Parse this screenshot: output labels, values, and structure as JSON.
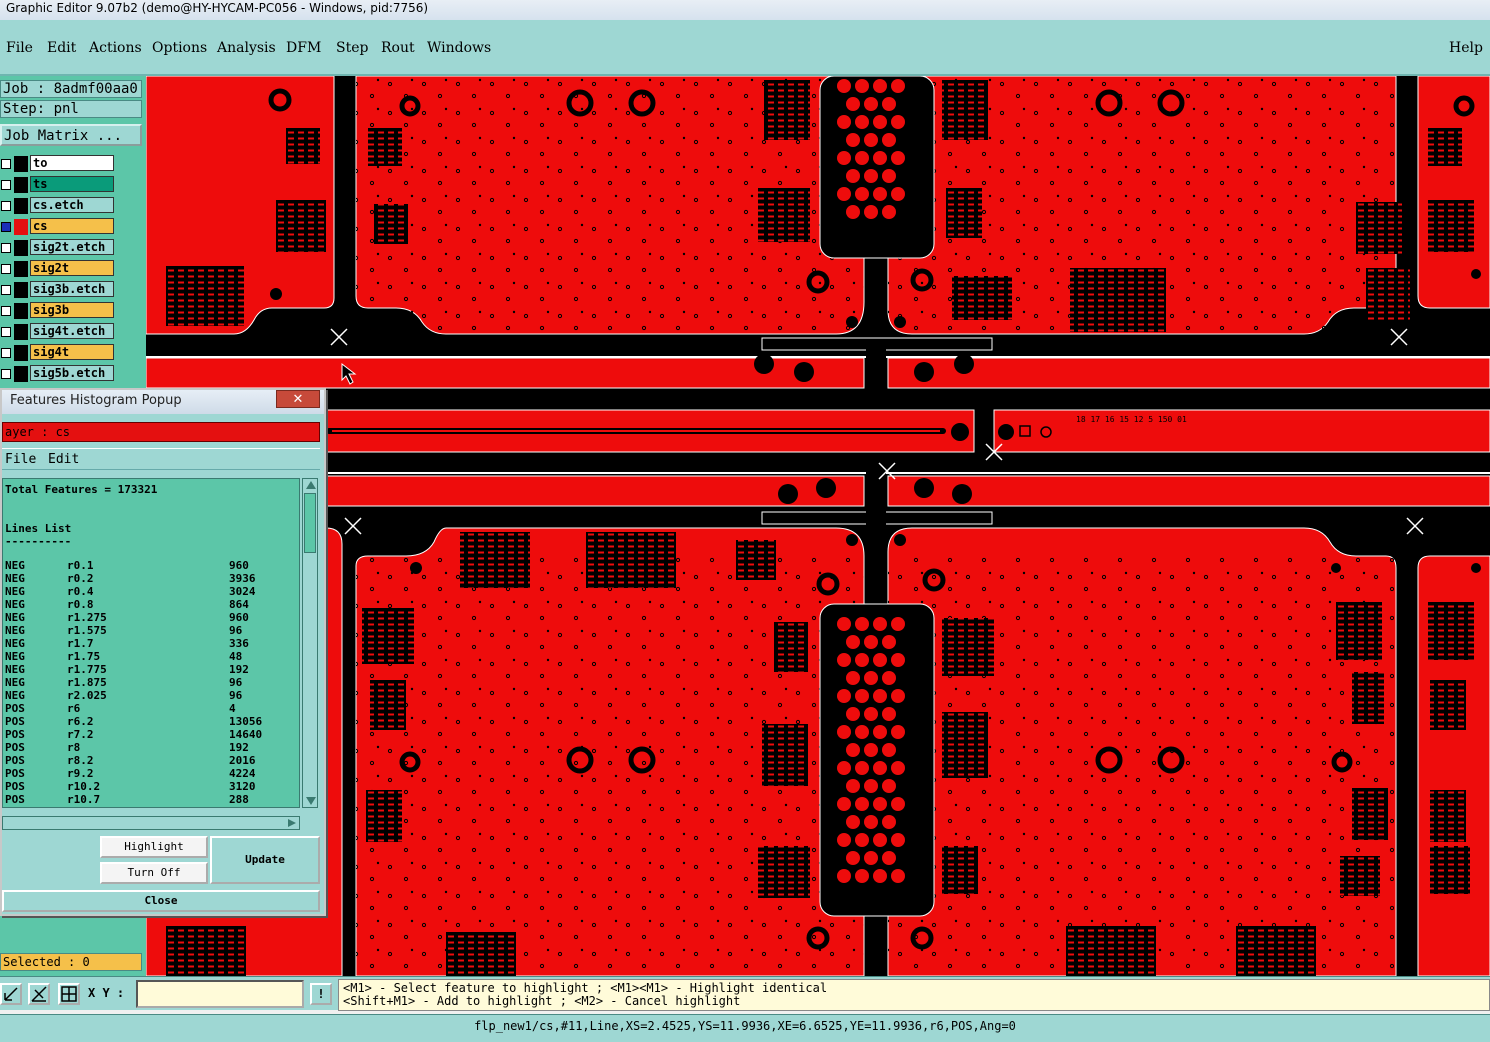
{
  "window": {
    "title": "Graphic Editor 9.07b2 (demo@HY-HYCAM-PC056 - Windows, pid:7756)"
  },
  "menu": {
    "items": [
      "File",
      "Edit",
      "Actions",
      "Options",
      "Analysis",
      "DFM",
      "Step",
      "Rout",
      "Windows"
    ],
    "help": "Help"
  },
  "job": {
    "label": "Job : 8admf00aa0",
    "step": "Step: pnl",
    "matrix_button": "Job Matrix ..."
  },
  "layers": [
    {
      "name": "to",
      "color": "#ffffff",
      "swatch": "#000000"
    },
    {
      "name": "ts",
      "color": "#0a9b7a",
      "swatch": "#000000"
    },
    {
      "name": "cs.etch",
      "color": "#9ed7d3",
      "swatch": "#000000"
    },
    {
      "name": "cs",
      "color": "#f5c04a",
      "swatch": "#e41010",
      "active": true
    },
    {
      "name": "sig2t.etch",
      "color": "#9ed7d3",
      "swatch": "#000000"
    },
    {
      "name": "sig2t",
      "color": "#f5c04a",
      "swatch": "#000000"
    },
    {
      "name": "sig3b.etch",
      "color": "#9ed7d3",
      "swatch": "#000000"
    },
    {
      "name": "sig3b",
      "color": "#f5c04a",
      "swatch": "#000000"
    },
    {
      "name": "sig4t.etch",
      "color": "#9ed7d3",
      "swatch": "#000000"
    },
    {
      "name": "sig4t",
      "color": "#f5c04a",
      "swatch": "#000000"
    },
    {
      "name": "sig5b.etch",
      "color": "#9ed7d3",
      "swatch": "#000000"
    }
  ],
  "selected": "Selected : 0",
  "popup": {
    "title": "Features Histogram Popup",
    "close_glyph": "✕",
    "layer": "ayer :  cs",
    "menu": [
      "File",
      "Edit"
    ],
    "total": "Total Features = 173321",
    "list_title": "Lines List",
    "list_rule": "----------",
    "rows": [
      [
        "NEG",
        "r0.1",
        "960"
      ],
      [
        "NEG",
        "r0.2",
        "3936"
      ],
      [
        "NEG",
        "r0.4",
        "3024"
      ],
      [
        "NEG",
        "r0.8",
        "864"
      ],
      [
        "NEG",
        "r1.275",
        "960"
      ],
      [
        "NEG",
        "r1.575",
        "96"
      ],
      [
        "NEG",
        "r1.7",
        "336"
      ],
      [
        "NEG",
        "r1.75",
        "48"
      ],
      [
        "NEG",
        "r1.775",
        "192"
      ],
      [
        "NEG",
        "r1.875",
        "96"
      ],
      [
        "NEG",
        "r2.025",
        "96"
      ],
      [
        "POS",
        "r6",
        "4"
      ],
      [
        "POS",
        "r6.2",
        "13056"
      ],
      [
        "POS",
        "r7.2",
        "14640"
      ],
      [
        "POS",
        "r8",
        "192"
      ],
      [
        "POS",
        "r8.2",
        "2016"
      ],
      [
        "POS",
        "r9.2",
        "4224"
      ],
      [
        "POS",
        "r10.2",
        "3120"
      ],
      [
        "POS",
        "r10.7",
        "288"
      ]
    ],
    "buttons": {
      "highlight": "Highlight",
      "turn_off": "Turn Off",
      "update": "Update",
      "close": "Close"
    }
  },
  "bottom": {
    "xy_label": "X Y :",
    "xy_value": "",
    "hint_line1": "<M1> - Select feature to highlight ; <M1><M1> - Highlight identical",
    "hint_line2": "<Shift+M1> - Add to highlight ; <M2> - Cancel highlight",
    "status": "flp_new1/cs,#11,Line,XS=2.4525,YS=11.9936,XE=6.6525,YE=11.9936,r6,POS,Ang=0",
    "info_glyph": "!"
  },
  "board_text": "18 17 16 15 12 5 150 01",
  "colors": {
    "copper": "#ee0c0c",
    "background": "#000000",
    "panel": "#9ed7d3",
    "panel_dark": "#5cc6a8"
  }
}
